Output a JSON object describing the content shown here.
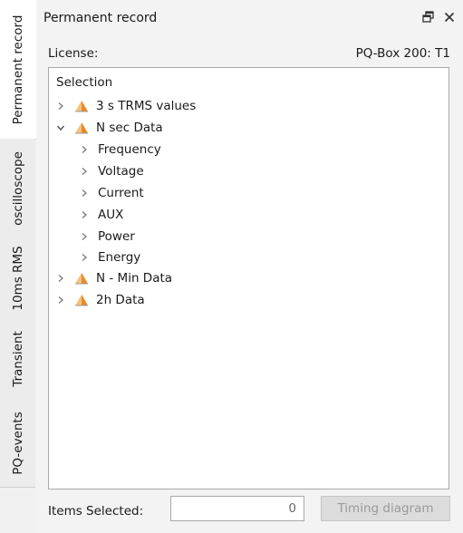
{
  "tabs": [
    {
      "label": "Permanent record",
      "active": true
    },
    {
      "label": "oscilloscope",
      "active": false
    },
    {
      "label": "10ms RMS",
      "active": false
    },
    {
      "label": "Transient",
      "active": false
    },
    {
      "label": "PQ-events",
      "active": false
    }
  ],
  "panel": {
    "title": "Permanent record",
    "icons": {
      "float": "float-window-icon",
      "close": "close-icon"
    }
  },
  "license": {
    "label": "License:",
    "value": "PQ-Box 200: T1"
  },
  "tree": {
    "header": "Selection",
    "nodes": [
      {
        "label": "3 s TRMS values",
        "expanded": false,
        "icon": "orange-triangle-icon"
      },
      {
        "label": "N sec Data",
        "expanded": true,
        "icon": "orange-triangle-icon",
        "children": [
          "Frequency",
          "Voltage",
          "Current",
          "AUX",
          "Power",
          "Energy"
        ]
      },
      {
        "label": "N - Min Data",
        "expanded": false,
        "icon": "orange-triangle-icon"
      },
      {
        "label": "2h Data",
        "expanded": false,
        "icon": "orange-triangle-icon"
      }
    ]
  },
  "footer": {
    "items_selected_label": "Items Selected:",
    "items_selected_value": "0",
    "timing_button": "Timing diagram"
  },
  "colors": {
    "accent_orange": "#e8892c",
    "accent_light": "#f6c27a"
  }
}
